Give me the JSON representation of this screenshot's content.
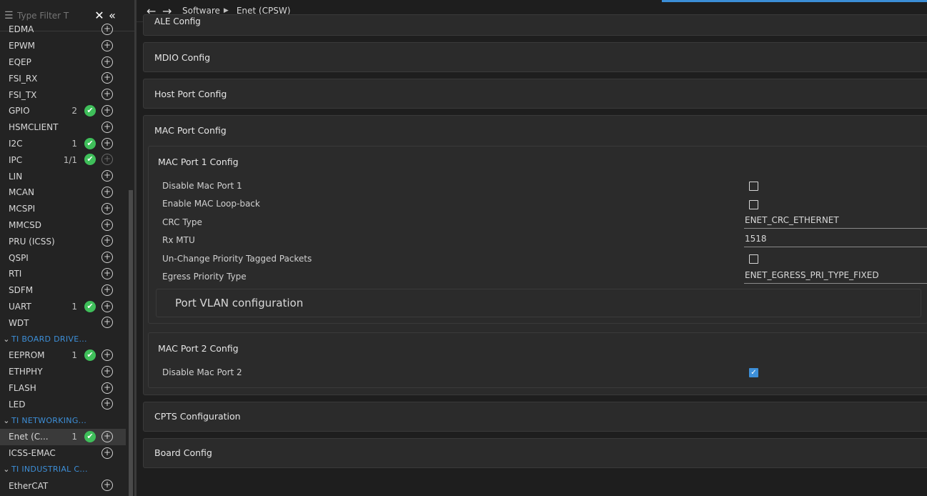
{
  "sidebar": {
    "filter_placeholder": "Type Filter T",
    "rows": [
      {
        "kind": "item",
        "name": "EDMA"
      },
      {
        "kind": "item",
        "name": "EPWM"
      },
      {
        "kind": "item",
        "name": "EQEP"
      },
      {
        "kind": "item",
        "name": "FSI_RX"
      },
      {
        "kind": "item",
        "name": "FSI_TX"
      },
      {
        "kind": "item",
        "name": "GPIO",
        "count": "2",
        "ok": true
      },
      {
        "kind": "item",
        "name": "HSMCLIENT"
      },
      {
        "kind": "item",
        "name": "I2C",
        "count": "1",
        "ok": true
      },
      {
        "kind": "item",
        "name": "IPC",
        "count": "1/1",
        "ok": true,
        "plus_dim": true
      },
      {
        "kind": "item",
        "name": "LIN"
      },
      {
        "kind": "item",
        "name": "MCAN"
      },
      {
        "kind": "item",
        "name": "MCSPI"
      },
      {
        "kind": "item",
        "name": "MMCSD"
      },
      {
        "kind": "item",
        "name": "PRU (ICSS)"
      },
      {
        "kind": "item",
        "name": "QSPI"
      },
      {
        "kind": "item",
        "name": "RTI"
      },
      {
        "kind": "item",
        "name": "SDFM"
      },
      {
        "kind": "item",
        "name": "UART",
        "count": "1",
        "ok": true
      },
      {
        "kind": "item",
        "name": "WDT"
      },
      {
        "kind": "group",
        "name": "TI BOARD DRIVE..."
      },
      {
        "kind": "item",
        "name": "EEPROM",
        "count": "1",
        "ok": true
      },
      {
        "kind": "item",
        "name": "ETHPHY"
      },
      {
        "kind": "item",
        "name": "FLASH"
      },
      {
        "kind": "item",
        "name": "LED"
      },
      {
        "kind": "group",
        "name": "TI NETWORKING..."
      },
      {
        "kind": "item",
        "name": "Enet (C...",
        "count": "1",
        "ok": true,
        "selected": true
      },
      {
        "kind": "item",
        "name": "ICSS-EMAC"
      },
      {
        "kind": "group",
        "name": "TI INDUSTRIAL C..."
      },
      {
        "kind": "item",
        "name": "EtherCAT"
      }
    ]
  },
  "breadcrumb": {
    "root": "Software",
    "current": "Enet (CPSW)"
  },
  "panels": {
    "cut": "ALE Config",
    "mdio": "MDIO Config",
    "host": "Host Port Config",
    "mac": "MAC Port Config",
    "cpts": "CPTS Configuration",
    "board": "Board Config"
  },
  "mac_port1": {
    "title": "MAC Port 1 Config",
    "disable_label": "Disable Mac Port 1",
    "loopback_label": "Enable MAC Loop-back",
    "crc_label": "CRC Type",
    "crc_value": "ENET_CRC_ETHERNET",
    "rxmtu_label": "Rx MTU",
    "rxmtu_value": "1518",
    "unchange_label": "Un-Change Priority Tagged Packets",
    "egress_label": "Egress Priority Type",
    "egress_value": "ENET_EGRESS_PRI_TYPE_FIXED",
    "vlan_label": "Port VLAN configuration"
  },
  "mac_port2": {
    "title": "MAC Port 2 Config",
    "disable_label": "Disable Mac Port 2",
    "disable_checked": true
  },
  "colors": {
    "accent": "#3d8fd8",
    "ok": "#3fbf5a"
  }
}
